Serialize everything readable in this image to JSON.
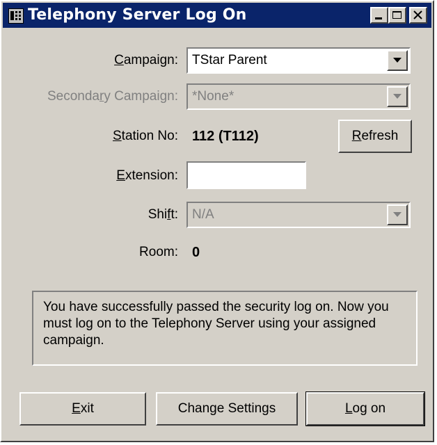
{
  "window": {
    "title": "Telephony Server Log On"
  },
  "form": {
    "campaign": {
      "label_pre": "",
      "label_key": "C",
      "label_post": "ampaign:",
      "value": "TStar Parent"
    },
    "secondary_campaign": {
      "label_pre": "Seconda",
      "label_key": "r",
      "label_post": "y Campaign:",
      "value": "*None*"
    },
    "station": {
      "label_pre": "",
      "label_key": "S",
      "label_post": "tation No:",
      "value": "112 (T112)"
    },
    "refresh_button": {
      "pre": "",
      "key": "R",
      "post": "efresh"
    },
    "extension": {
      "label_pre": "",
      "label_key": "E",
      "label_post": "xtension:",
      "value": ""
    },
    "shift": {
      "label_pre": "Shi",
      "label_key": "f",
      "label_post": "t:",
      "value": "N/A"
    },
    "room": {
      "label": "Room:",
      "value": "0"
    }
  },
  "message": "You have successfully passed the security log on. Now you must log on to the Telephony Server using your assigned campaign.",
  "buttons": {
    "exit": {
      "pre": "",
      "key": "E",
      "post": "xit"
    },
    "change_settings": "Change Settings",
    "log_on": {
      "pre": "",
      "key": "L",
      "post": "og on"
    }
  }
}
